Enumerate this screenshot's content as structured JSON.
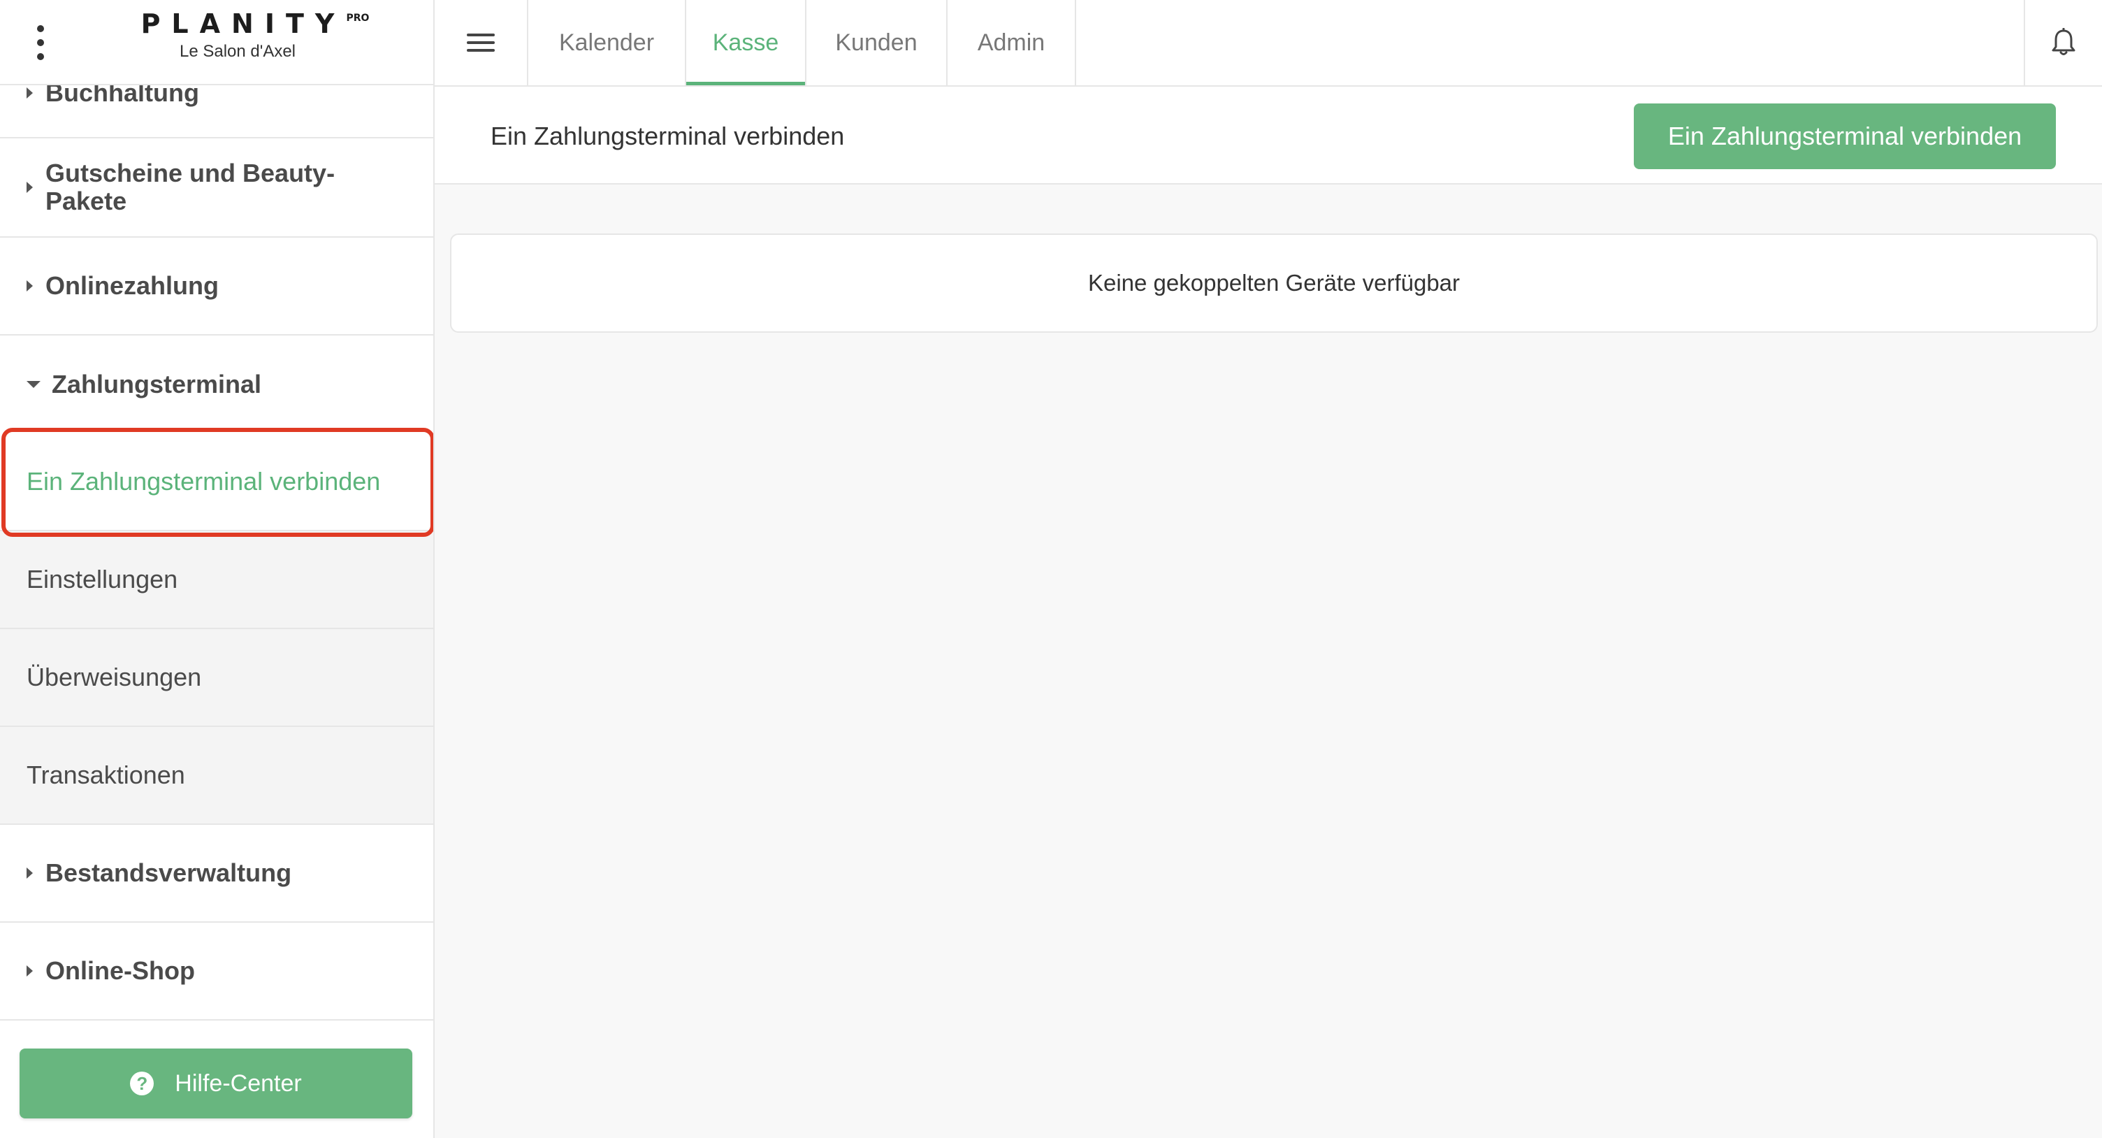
{
  "brand": {
    "logo_text": "PLANITY",
    "logo_badge": "PRO",
    "salon_name": "Le Salon d'Axel"
  },
  "sidebar": {
    "items": [
      {
        "label": "Buchhaltung",
        "expanded": false
      },
      {
        "label": "Gutscheine und Beauty-Pakete",
        "expanded": false
      },
      {
        "label": "Onlinezahlung",
        "expanded": false
      },
      {
        "label": "Zahlungsterminal",
        "expanded": true,
        "children": [
          {
            "label": "Ein Zahlungsterminal verbinden",
            "active": true
          },
          {
            "label": "Einstellungen",
            "active": false
          },
          {
            "label": "Überweisungen",
            "active": false
          },
          {
            "label": "Transaktionen",
            "active": false
          }
        ]
      },
      {
        "label": "Bestandsverwaltung",
        "expanded": false
      },
      {
        "label": "Online-Shop",
        "expanded": false
      }
    ],
    "help_button": "Hilfe-Center",
    "help_icon": "?"
  },
  "topbar": {
    "tabs": [
      {
        "label": "Kalender",
        "active": false
      },
      {
        "label": "Kasse",
        "active": true
      },
      {
        "label": "Kunden",
        "active": false
      },
      {
        "label": "Admin",
        "active": false
      }
    ]
  },
  "main": {
    "title": "Ein Zahlungsterminal verbinden",
    "connect_button": "Ein Zahlungsterminal verbinden",
    "empty_message": "Keine gekoppelten Geräte verfügbar"
  },
  "colors": {
    "accent": "#68b67f",
    "accent_text": "#5bb37a",
    "highlight": "#e03a24"
  },
  "icons": [
    "kebab-menu-icon",
    "hamburger-menu-icon",
    "bell-icon",
    "caret-right-icon",
    "caret-down-icon",
    "question-circle-icon"
  ]
}
